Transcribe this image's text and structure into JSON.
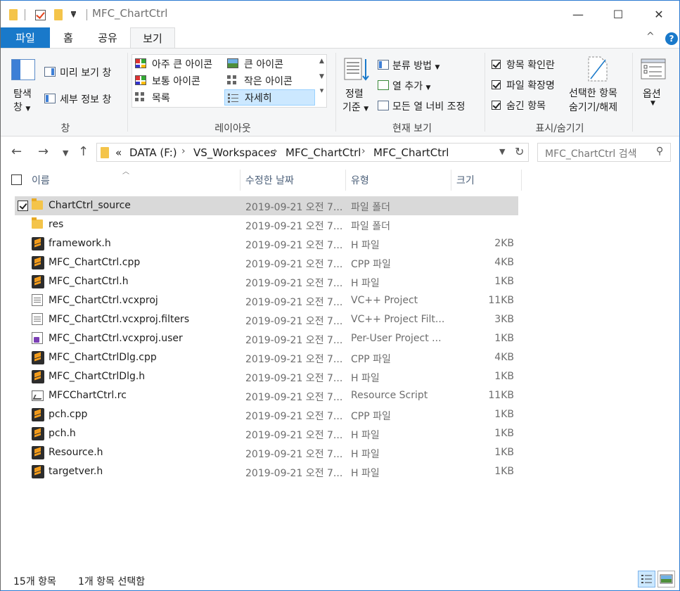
{
  "window": {
    "title": "MFC_ChartCtrl",
    "minimize_glyph": "—",
    "maximize_glyph": "☐",
    "close_glyph": "✕"
  },
  "ribbon_tabs": {
    "file": "파일",
    "home": "홈",
    "share": "공유",
    "view": "보기",
    "collapse_glyph": "^",
    "help_glyph": "?"
  },
  "ribbon": {
    "pane_group": {
      "nav_pane_label_1": "탐색",
      "nav_pane_label_2": "창",
      "preview_pane": "미리 보기 창",
      "details_pane": "세부 정보 창",
      "group_label": "창"
    },
    "layout_group": {
      "items": [
        "아주 큰 아이콘",
        "큰 아이콘",
        "보통 아이콘",
        "작은 아이콘",
        "목록",
        "자세히"
      ],
      "selected": "자세히",
      "group_label": "레이아웃"
    },
    "current_view_group": {
      "sort_label_1": "정렬",
      "sort_label_2": "기준",
      "group_by": "분류 방법",
      "add_column": "열 추가",
      "fit_columns": "모든 열 너비 조정",
      "group_label": "현재 보기"
    },
    "show_hide_group": {
      "item_checkboxes": "항목 확인란",
      "file_extensions": "파일 확장명",
      "hidden_items": "숨긴 항목",
      "hide_selected_1": "선택한 항목",
      "hide_selected_2": "숨기기/해제",
      "group_label": "표시/숨기기"
    },
    "options": {
      "label": "옵션"
    }
  },
  "address": {
    "overflow": "«",
    "crumbs": [
      "DATA (F:)",
      "VS_Workspaces",
      "MFC_ChartCtrl",
      "MFC_ChartCtrl"
    ],
    "search_placeholder": "MFC_ChartCtrl 검색"
  },
  "columns": {
    "name": "이름",
    "modified": "수정한 날짜",
    "type": "유형",
    "size": "크기"
  },
  "files": [
    {
      "name": "ChartCtrl_source",
      "date": "2019-09-21 오전 7...",
      "type": "파일 폴더",
      "size": "",
      "icon": "folder-icon",
      "selected": true
    },
    {
      "name": "res",
      "date": "2019-09-21 오전 7...",
      "type": "파일 폴더",
      "size": "",
      "icon": "folder-icon"
    },
    {
      "name": "framework.h",
      "date": "2019-09-21 오전 7...",
      "type": "H 파일",
      "size": "2KB",
      "icon": "sublime-file-icon"
    },
    {
      "name": "MFC_ChartCtrl.cpp",
      "date": "2019-09-21 오전 7...",
      "type": "CPP 파일",
      "size": "4KB",
      "icon": "sublime-file-icon"
    },
    {
      "name": "MFC_ChartCtrl.h",
      "date": "2019-09-21 오전 7...",
      "type": "H 파일",
      "size": "1KB",
      "icon": "sublime-file-icon"
    },
    {
      "name": "MFC_ChartCtrl.vcxproj",
      "date": "2019-09-21 오전 7...",
      "type": "VC++ Project",
      "size": "11KB",
      "icon": "vcxproj-icon"
    },
    {
      "name": "MFC_ChartCtrl.vcxproj.filters",
      "date": "2019-09-21 오전 7...",
      "type": "VC++ Project Filt...",
      "size": "3KB",
      "icon": "filters-icon"
    },
    {
      "name": "MFC_ChartCtrl.vcxproj.user",
      "date": "2019-09-21 오전 7...",
      "type": "Per-User Project ...",
      "size": "1KB",
      "icon": "vs-user-icon"
    },
    {
      "name": "MFC_ChartCtrlDlg.cpp",
      "date": "2019-09-21 오전 7...",
      "type": "CPP 파일",
      "size": "4KB",
      "icon": "sublime-file-icon"
    },
    {
      "name": "MFC_ChartCtrlDlg.h",
      "date": "2019-09-21 오전 7...",
      "type": "H 파일",
      "size": "1KB",
      "icon": "sublime-file-icon"
    },
    {
      "name": "MFCChartCtrl.rc",
      "date": "2019-09-21 오전 7...",
      "type": "Resource Script",
      "size": "11KB",
      "icon": "resource-script-icon"
    },
    {
      "name": "pch.cpp",
      "date": "2019-09-21 오전 7...",
      "type": "CPP 파일",
      "size": "1KB",
      "icon": "sublime-file-icon"
    },
    {
      "name": "pch.h",
      "date": "2019-09-21 오전 7...",
      "type": "H 파일",
      "size": "1KB",
      "icon": "sublime-file-icon"
    },
    {
      "name": "Resource.h",
      "date": "2019-09-21 오전 7...",
      "type": "H 파일",
      "size": "1KB",
      "icon": "sublime-file-icon"
    },
    {
      "name": "targetver.h",
      "date": "2019-09-21 오전 7...",
      "type": "H 파일",
      "size": "1KB",
      "icon": "sublime-file-icon"
    }
  ],
  "status": {
    "item_count": "15개 항목",
    "selected_count": "1개 항목 선택함"
  },
  "colors": {
    "accent": "#1979ca",
    "selection": "#d9d9d9"
  }
}
